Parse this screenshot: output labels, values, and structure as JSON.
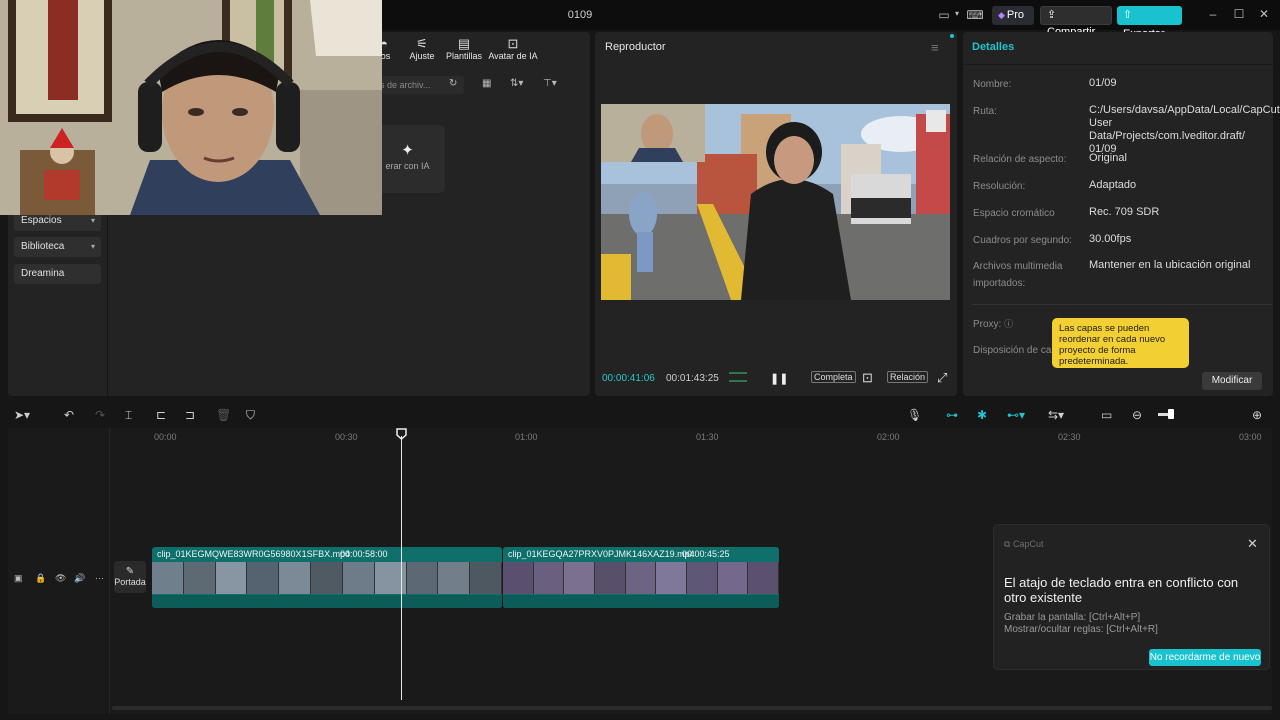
{
  "window": {
    "title": "0109"
  },
  "topbar": {
    "pro_label": "Pro",
    "share_label": "Compartir",
    "export_label": "Exportar"
  },
  "media_tabs": [
    {
      "label": "ros"
    },
    {
      "label": "Ajuste"
    },
    {
      "label": "Plantillas"
    },
    {
      "label": "Avatar de IA"
    }
  ],
  "search": {
    "placeholder": "res de archiv..."
  },
  "ai_card": {
    "label": "erar con IA"
  },
  "sidebar": {
    "items": [
      {
        "label": "Espacios"
      },
      {
        "label": "Biblioteca"
      },
      {
        "label": "Dreamina"
      }
    ]
  },
  "player": {
    "title": "Reproductor",
    "current_time": "00:00:41:06",
    "total_time": "00:01:43:25",
    "full_label": "Completa",
    "ratio_label": "Relación"
  },
  "details": {
    "title": "Detalles",
    "rows": [
      {
        "label": "Nombre:",
        "value": "01/09"
      },
      {
        "label": "Ruta:",
        "value": "C:/Users/davsa/AppData/Local/CapCut/ User Data/Projects/com.lveditor.draft/ 01/09"
      },
      {
        "label": "Relación de aspecto:",
        "value": "Original"
      },
      {
        "label": "Resolución:",
        "value": "Adaptado"
      },
      {
        "label": "Espacio cromático",
        "value": "Rec. 709 SDR"
      },
      {
        "label": "Cuadros por segundo:",
        "value": "30.00fps"
      },
      {
        "label": "Archivos multimedia importados:",
        "value": "Mantener en la ubicación original"
      },
      {
        "label": "Proxy:",
        "value": ""
      },
      {
        "label": "Disposición de ca",
        "value": ""
      }
    ],
    "tooltip": "Las capas se pueden reordenar en cada nuevo proyecto de forma predeterminada.",
    "modify_label": "Modificar"
  },
  "timeline": {
    "ticks": [
      "00:00",
      "00:30",
      "01:00",
      "01:30",
      "02:00",
      "02:30",
      "03:00"
    ],
    "cover_label": "Portada",
    "clips": [
      {
        "name": "clip_01KEGMQWE83WR0G56980X1SFBX.mp4",
        "duration": "00:00:58:00"
      },
      {
        "name": "clip_01KEGQA27PRXV0PJMK146XAZ19.mp4",
        "duration": "00:00:45:25"
      }
    ]
  },
  "notification": {
    "brand": "CapCut",
    "title": "El atajo de teclado entra en conflicto con otro existente",
    "line1": "Grabar la pantalla: [Ctrl+Alt+P]",
    "line2": "Mostrar/ocultar reglas: [Ctrl+Alt+R]",
    "button": "No recordarme de nuevo"
  },
  "colors": {
    "accent": "#18c3cf",
    "tooltip": "#f2cf33",
    "clip": "#0f6f6a"
  }
}
